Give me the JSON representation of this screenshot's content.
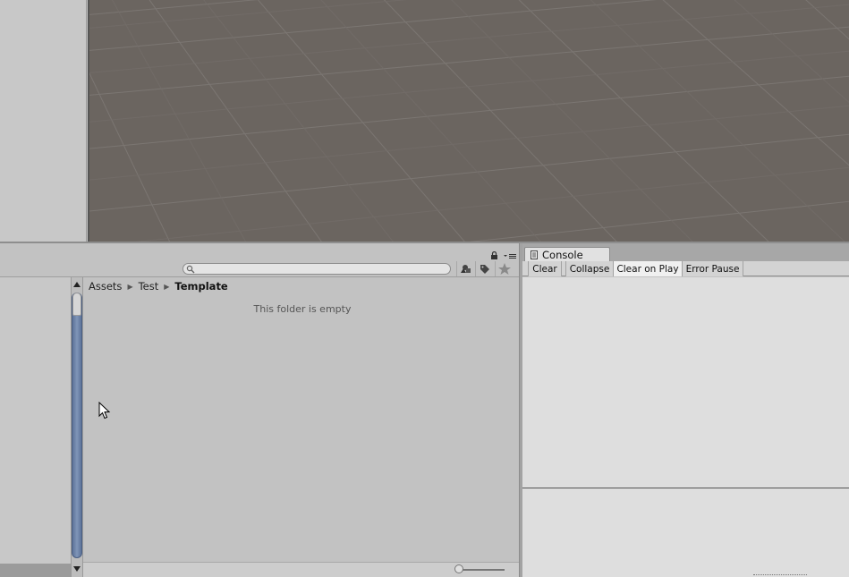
{
  "project": {
    "search_placeholder": "",
    "breadcrumb": [
      "Assets",
      "Test",
      "Template"
    ],
    "empty_message": "This folder is empty"
  },
  "console": {
    "tab_label": "Console",
    "buttons": {
      "clear": "Clear",
      "collapse": "Collapse",
      "clear_on_play": "Clear on Play",
      "error_pause": "Error Pause"
    }
  },
  "colors": {
    "scene_ground": "#6b6560",
    "panel_bg": "#c2c2c2",
    "scroll_thumb": "#6f86ad",
    "console_bg": "#dedede"
  },
  "icons": [
    "lock-icon",
    "panel-menu-icon",
    "search-icon",
    "filter-by-type-icon",
    "filter-by-label-icon",
    "favorite-star-icon",
    "console-icon",
    "mouse-cursor-icon"
  ]
}
